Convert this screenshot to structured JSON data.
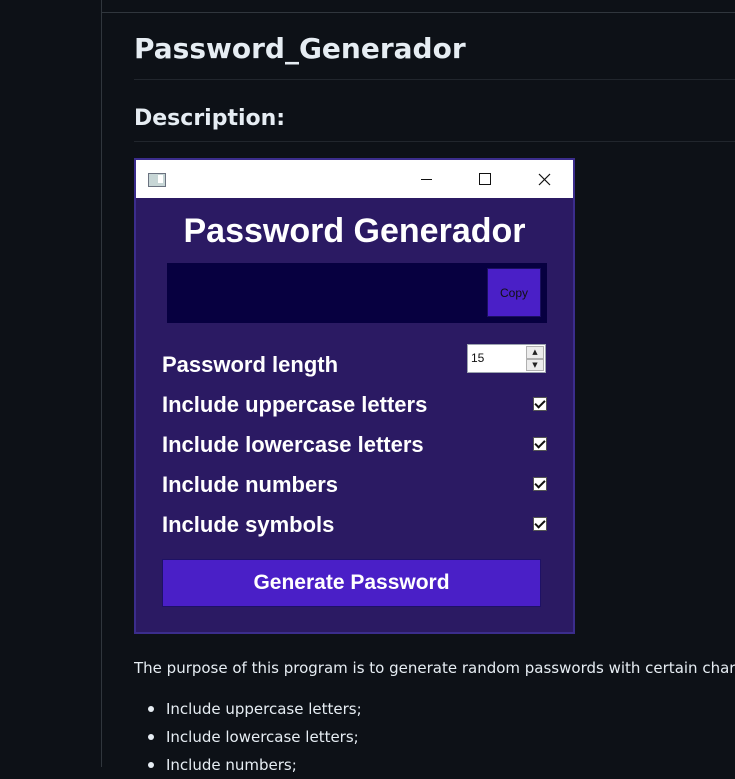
{
  "page": {
    "title": "Password_Generador",
    "description_heading": "Description:",
    "description_text": "The purpose of this program is to generate random passwords with certain characters",
    "features": [
      "Include uppercase letters;",
      "Include lowercase letters;",
      "Include numbers;"
    ]
  },
  "app": {
    "title": "Password Generador",
    "output_value": "",
    "copy_label": "Copy",
    "password_length_label": "Password length",
    "password_length_value": "15",
    "options": [
      {
        "label": "Include uppercase letters",
        "checked": true
      },
      {
        "label": "Include lowercase letters",
        "checked": true
      },
      {
        "label": "Include numbers",
        "checked": true
      },
      {
        "label": "Include symbols",
        "checked": true
      }
    ],
    "generate_label": "Generate Password",
    "titlebar_icons": [
      "app-icon",
      "minimize-icon",
      "maximize-icon",
      "close-icon"
    ]
  },
  "colors": {
    "page_background": "#0d1117",
    "app_background": "#2b1a63",
    "output_background": "#070040",
    "button_accent": "#4a1fc7",
    "text_light": "#ffffff"
  }
}
